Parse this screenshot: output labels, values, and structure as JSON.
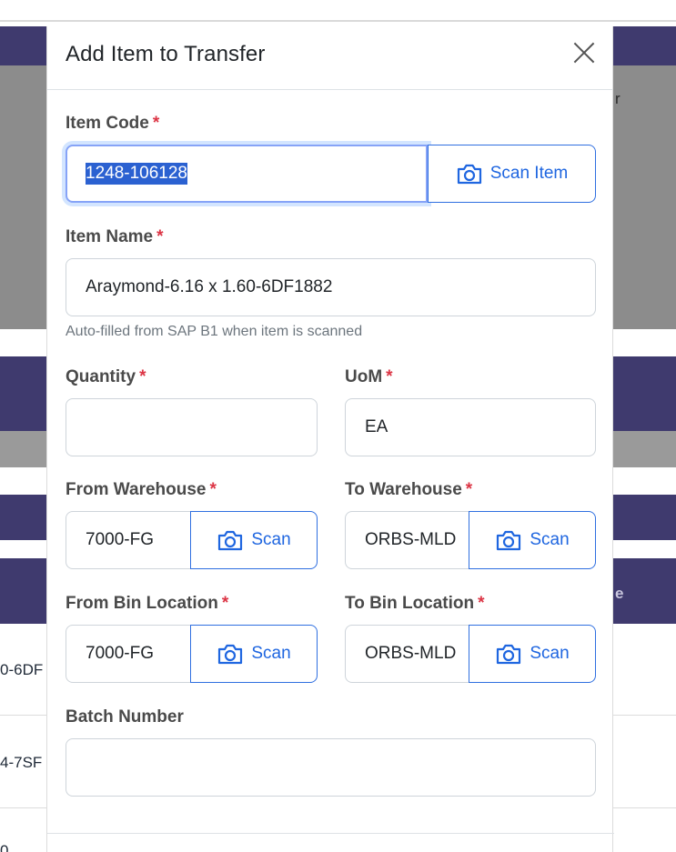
{
  "background": {
    "row_fragments": [
      "0-6DF",
      "4-7SF",
      "0"
    ],
    "edge_letter": "r",
    "header_fragment": "e"
  },
  "modal": {
    "title": "Add Item to Transfer",
    "item_code": {
      "label": "Item Code",
      "required_mark": "*",
      "value": "1248-106128",
      "scan_label": "Scan Item"
    },
    "item_name": {
      "label": "Item Name",
      "required_mark": "*",
      "value": "Araymond-6.16 x 1.60-6DF1882",
      "help": "Auto-filled from SAP B1 when item is scanned"
    },
    "quantity": {
      "label": "Quantity",
      "required_mark": "*",
      "value": ""
    },
    "uom": {
      "label": "UoM",
      "required_mark": "*",
      "value": "EA"
    },
    "from_warehouse": {
      "label": "From Warehouse",
      "required_mark": "*",
      "value": "7000-FG",
      "scan_label": "Scan"
    },
    "to_warehouse": {
      "label": "To Warehouse",
      "required_mark": "*",
      "value": "ORBS-MLD",
      "scan_label": "Scan"
    },
    "from_bin": {
      "label": "From Bin Location",
      "required_mark": "*",
      "value": "7000-FG",
      "scan_label": "Scan"
    },
    "to_bin": {
      "label": "To Bin Location",
      "required_mark": "*",
      "value": "ORBS-MLD",
      "scan_label": "Scan"
    },
    "batch_number": {
      "label": "Batch Number",
      "value": ""
    }
  },
  "colors": {
    "accent": "#1f66e0",
    "required": "#dc3545",
    "selection": "#2b61d1",
    "background_purple": "#3f3a6e"
  },
  "icons": {
    "close": "close-icon",
    "scan": "camera-icon"
  }
}
